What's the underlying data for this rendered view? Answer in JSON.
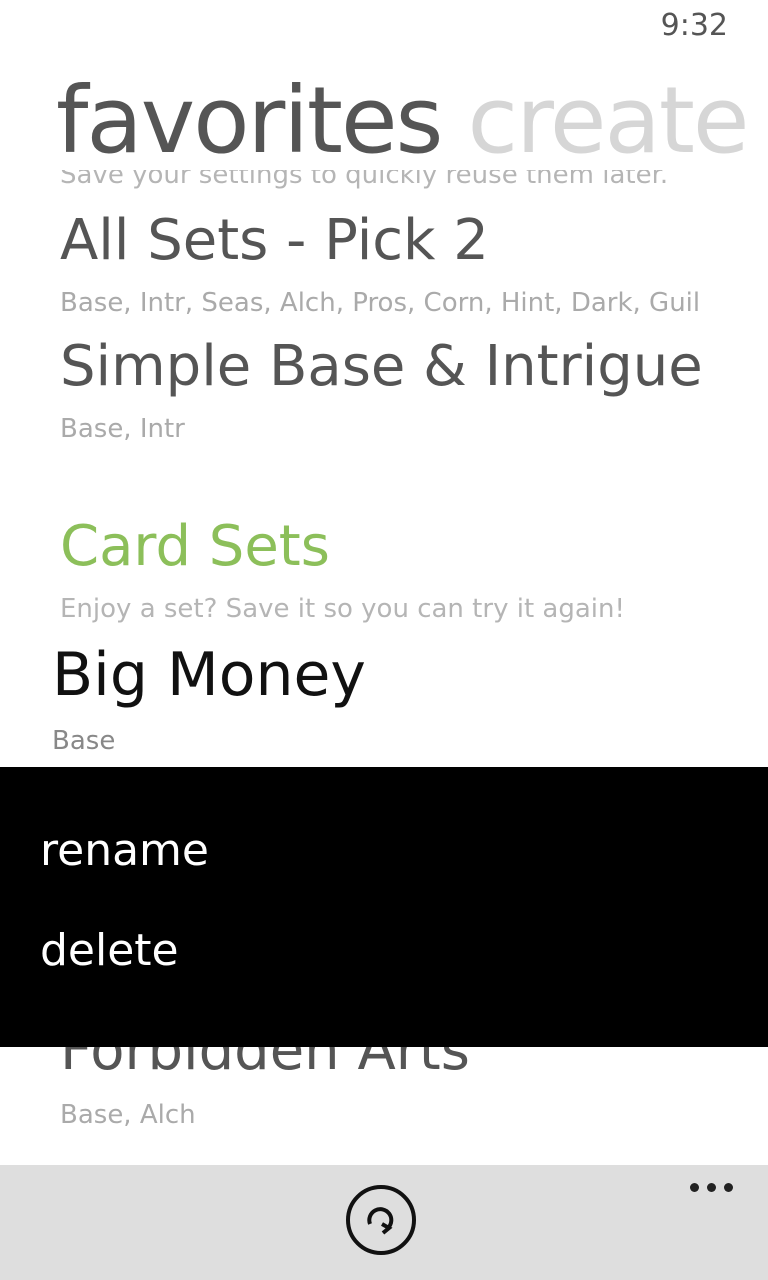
{
  "status_bar": {
    "time": "9:32"
  },
  "pivot": {
    "active": "favorites",
    "next": "create"
  },
  "list": {
    "cut_top_text": "Save your settings to quickly reuse them later.",
    "items_top": [
      {
        "title": "All Sets - Pick 2",
        "sub": "Base, Intr, Seas, Alch, Pros, Corn, Hint, Dark, Guil"
      },
      {
        "title": "Simple Base & Intrigue",
        "sub": "Base, Intr"
      }
    ],
    "section": {
      "title": "Card Sets",
      "sub": "Enjoy a set? Save it so you can try it again!"
    },
    "selected_item": {
      "title": "Big Money",
      "sub": "Base"
    },
    "item_below": {
      "title": "Forbidden Arts",
      "sub": "Base, Alch"
    }
  },
  "context_menu": {
    "items": [
      "rename",
      "delete"
    ]
  },
  "app_bar": {
    "refresh_icon": "refresh-icon",
    "more_icon": "ellipsis-icon"
  }
}
